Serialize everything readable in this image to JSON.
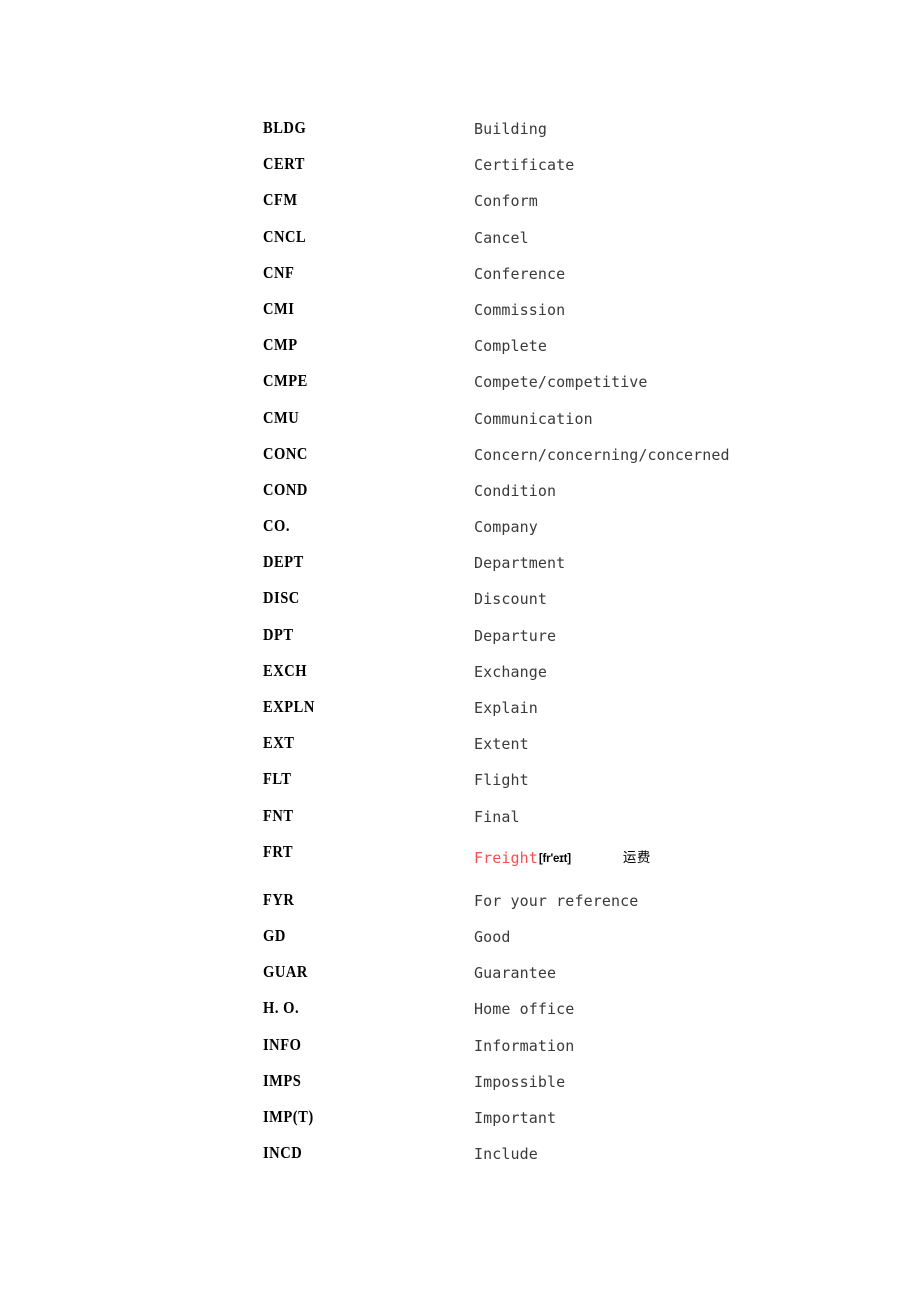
{
  "document": {
    "type": "abbreviation-glossary",
    "background_color": "#ffffff",
    "text_color": "#000000",
    "meaning_color": "#3a3a3a",
    "highlight_color": "#f94f4f"
  },
  "entries": [
    {
      "abbr": "BLDG",
      "meaning": "Building"
    },
    {
      "abbr": "CERT",
      "meaning": "Certificate"
    },
    {
      "abbr": "CFM",
      "meaning": "Conform"
    },
    {
      "abbr": "CNCL",
      "meaning": "Cancel"
    },
    {
      "abbr": "CNF",
      "meaning": "Conference"
    },
    {
      "abbr": "CMI",
      "meaning": "Commission"
    },
    {
      "abbr": "CMP",
      "meaning": "Complete"
    },
    {
      "abbr": "CMPE",
      "meaning": "Compete/competitive"
    },
    {
      "abbr": "CMU",
      "meaning": "Communication"
    },
    {
      "abbr": "CONC",
      "meaning": "Concern/concerning/concerned"
    },
    {
      "abbr": "COND",
      "meaning": "Condition"
    },
    {
      "abbr": "CO.",
      "meaning": "Company"
    },
    {
      "abbr": "DEPT",
      "meaning": "Department"
    },
    {
      "abbr": "DISC",
      "meaning": "Discount"
    },
    {
      "abbr": "DPT",
      "meaning": "Departure"
    },
    {
      "abbr": "EXCH",
      "meaning": "Exchange"
    },
    {
      "abbr": "EXPLN",
      "meaning": "Explain"
    },
    {
      "abbr": "EXT",
      "meaning": "Extent"
    },
    {
      "abbr": "FLT",
      "meaning": "Flight"
    },
    {
      "abbr": "FNT",
      "meaning": "Final"
    },
    {
      "abbr": "FRT",
      "meaning": "Freight",
      "highlighted": true,
      "phonetic": "[fr'eɪt]",
      "translation": "运费"
    },
    {
      "abbr": "FYR",
      "meaning": "For your reference"
    },
    {
      "abbr": "GD",
      "meaning": "Good"
    },
    {
      "abbr": "GUAR",
      "meaning": "Guarantee"
    },
    {
      "abbr": "H. O.",
      "meaning": "Home office"
    },
    {
      "abbr": "INFO",
      "meaning": "Information"
    },
    {
      "abbr": "IMPS",
      "meaning": "Impossible"
    },
    {
      "abbr": "IMP(T)",
      "meaning": "Important"
    },
    {
      "abbr": "INCD",
      "meaning": "Include"
    }
  ]
}
